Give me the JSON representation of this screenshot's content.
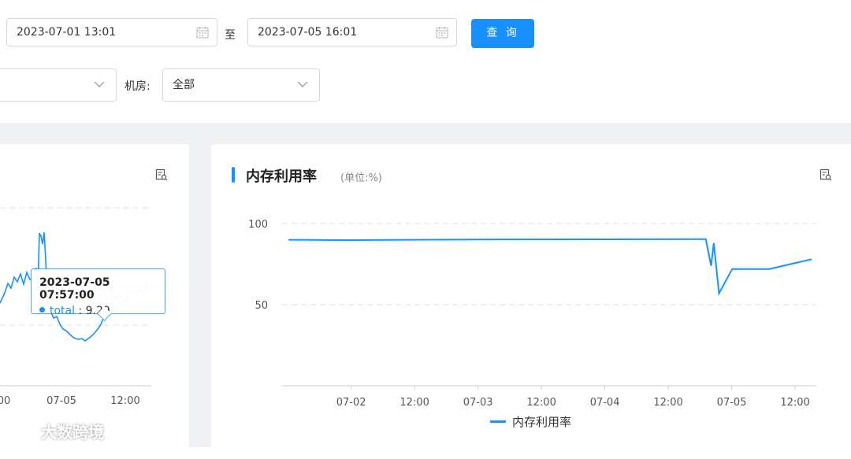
{
  "filters": {
    "start_datetime": "2023-07-01 13:01",
    "end_datetime": "2023-07-05 16:01",
    "range_separator": "至",
    "query_button": "查 询",
    "room_label": "机房:",
    "room_value": "全部"
  },
  "left_chart": {
    "x_ticks": [
      "00",
      "07-05",
      "12:00"
    ],
    "tooltip": {
      "time": "2023-07-05 07:57:00",
      "series": "total",
      "value": ": 9.29"
    }
  },
  "memory_chart": {
    "title": "内存利用率",
    "unit": "(单位:%)",
    "legend": "内存利用率"
  },
  "chart_data": {
    "type": "line",
    "title": "内存利用率",
    "subtitle": "(单位:%)",
    "y_ticks": [
      "100",
      "50"
    ],
    "y_tick_values": [
      100,
      50
    ],
    "x_tick_labels": [
      "07-02",
      "12:00",
      "07-03",
      "12:00",
      "07-04",
      "12:00",
      "07-05",
      "12:00"
    ],
    "x": [
      "07-01 13:01",
      "07-02 00:00",
      "07-03 00:00",
      "07-04 00:00",
      "07-04 20:00",
      "07-04 21:00",
      "07-04 21:30",
      "07-04 22:30",
      "07-05 01:00",
      "07-05 04:00",
      "07-05 08:00",
      "07-05 12:00",
      "07-05 16:01"
    ],
    "series": [
      {
        "name": "内存利用率",
        "values": [
          90,
          89.8,
          90.2,
          90.3,
          90.4,
          74,
          88,
          57,
          72,
          72,
          72,
          75,
          78
        ]
      }
    ],
    "ylim": [
      0,
      100
    ],
    "grid": true,
    "legend": "bottom-center",
    "color": "#1890ff"
  },
  "watermark": "大数跨境"
}
